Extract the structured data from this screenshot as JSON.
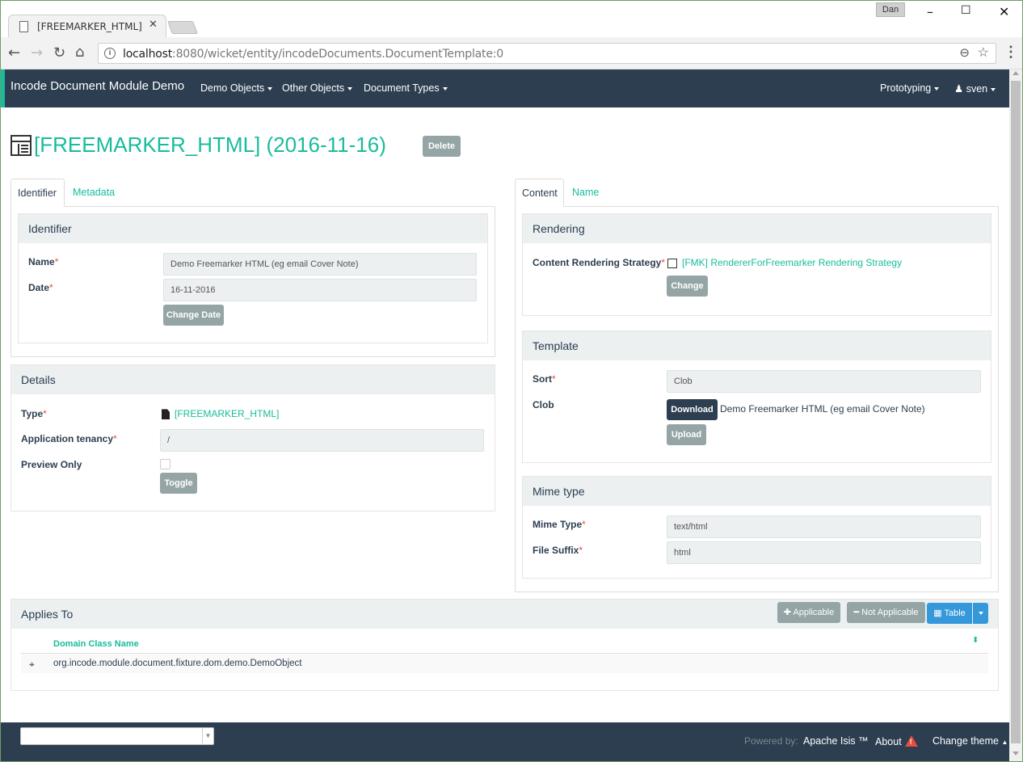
{
  "browser": {
    "tab_title": "[FREEMARKER_HTML] (2016-11-16)",
    "profile": "Dan",
    "url_host": "localhost",
    "url_rest": ":8080/wicket/entity/incodeDocuments.DocumentTemplate:0"
  },
  "navbar": {
    "brand": "Incode Document Module Demo",
    "menus": [
      "Demo Objects",
      "Other Objects",
      "Document Types"
    ],
    "prototyping": "Prototyping",
    "user": "sven"
  },
  "page": {
    "title": "[FREEMARKER_HTML] (2016-11-16)",
    "delete_label": "Delete"
  },
  "left": {
    "tabs": [
      "Identifier",
      "Metadata"
    ],
    "identifier_panel": {
      "heading": "Identifier",
      "name_label": "Name",
      "name_value": "Demo Freemarker HTML (eg email Cover Note)",
      "date_label": "Date",
      "date_value": "16-11-2016",
      "change_date_label": "Change Date"
    },
    "details_panel": {
      "heading": "Details",
      "type_label": "Type",
      "type_value": "[FREEMARKER_HTML]",
      "tenancy_label": "Application tenancy",
      "tenancy_value": "/",
      "preview_label": "Preview Only",
      "toggle_label": "Toggle"
    }
  },
  "right": {
    "tabs": [
      "Content",
      "Name"
    ],
    "rendering_panel": {
      "heading": "Rendering",
      "strategy_label": "Content Rendering Strategy",
      "strategy_value": "[FMK] RendererForFreemarker Rendering Strategy",
      "change_label": "Change"
    },
    "template_panel": {
      "heading": "Template",
      "sort_label": "Sort",
      "sort_value": "Clob",
      "clob_label": "Clob",
      "download_label": "Download",
      "clob_name": "Demo Freemarker HTML (eg email Cover Note)",
      "upload_label": "Upload"
    },
    "mime_panel": {
      "heading": "Mime type",
      "mime_label": "Mime Type",
      "mime_value": "text/html",
      "suffix_label": "File Suffix",
      "suffix_value": "html"
    }
  },
  "applies_to": {
    "heading": "Applies To",
    "applicable_label": "Applicable",
    "not_applicable_label": "Not Applicable",
    "table_label": "Table",
    "column_header": "Domain Class Name",
    "rows": [
      "org.incode.module.document.fixture.dom.demo.DemoObject"
    ]
  },
  "footer": {
    "powered_by": "Powered by:",
    "apache_isis": "Apache Isis ™",
    "about": "About",
    "change_theme": "Change theme"
  },
  "colors": {
    "navbar": "#2c3e50",
    "accent": "#18bc9c",
    "button": "#95a5a6",
    "primary": "#3498db",
    "required": "#e74c3c"
  }
}
